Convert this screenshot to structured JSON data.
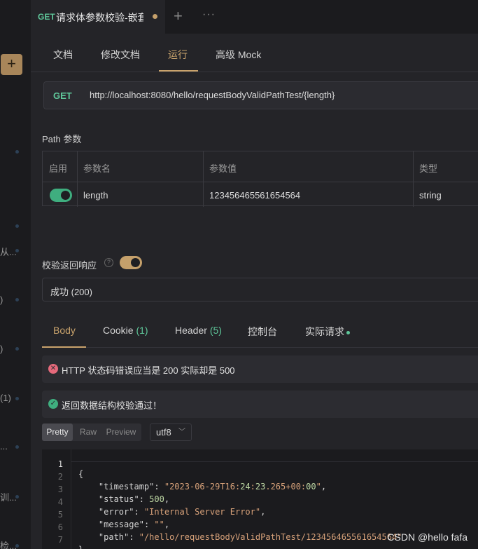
{
  "left_sidebar": {
    "add_label": "+",
    "truncated_items": [
      "从...",
      ")",
      ")",
      "(1)",
      "...",
      "训...",
      "检..."
    ]
  },
  "tabbar": {
    "method": "GET",
    "title": "请求体参数校验-嵌套",
    "new_tab": "+",
    "more": "···"
  },
  "subtabs": [
    "文档",
    "修改文档",
    "运行",
    "高级 Mock"
  ],
  "request": {
    "method": "GET",
    "url": "http://localhost:8080/hello/requestBodyValidPathTest/{length}"
  },
  "path_params": {
    "title": "Path 参数",
    "headers": [
      "启用",
      "参数名",
      "参数值",
      "类型"
    ],
    "rows": [
      {
        "enabled": true,
        "name": "length",
        "value": "123456465561654564",
        "type": "string"
      }
    ]
  },
  "validation": {
    "label": "校验返回响应",
    "help_glyph": "?",
    "response_option": "成功 (200)"
  },
  "response_tabs": {
    "body": "Body",
    "cookie": "Cookie",
    "cookie_count": "(1)",
    "header": "Header",
    "header_count": "(5)",
    "console": "控制台",
    "actual": "实际请求"
  },
  "alerts": {
    "error": "HTTP 状态码错误应当是 200 实际却是 500",
    "success": "返回数据结构校验通过！"
  },
  "view": {
    "modes": [
      "Pretty",
      "Raw",
      "Preview"
    ],
    "encoding": "utf8"
  },
  "code_lines": [
    "{",
    "    \"timestamp\": \"2023-06-29T16:24:23.265+00:00\",",
    "    \"status\": 500,",
    "    \"error\": \"Internal Server Error\",",
    "    \"message\": \"\",",
    "    \"path\": \"/hello/requestBodyValidPathTest/123456465561654564\"",
    "}"
  ],
  "watermark": "CSDN @hello fafa",
  "colors": {
    "accent": "#c9a36c",
    "method_green": "#5fc79a",
    "error": "#e5697b",
    "success": "#3fae7f"
  }
}
